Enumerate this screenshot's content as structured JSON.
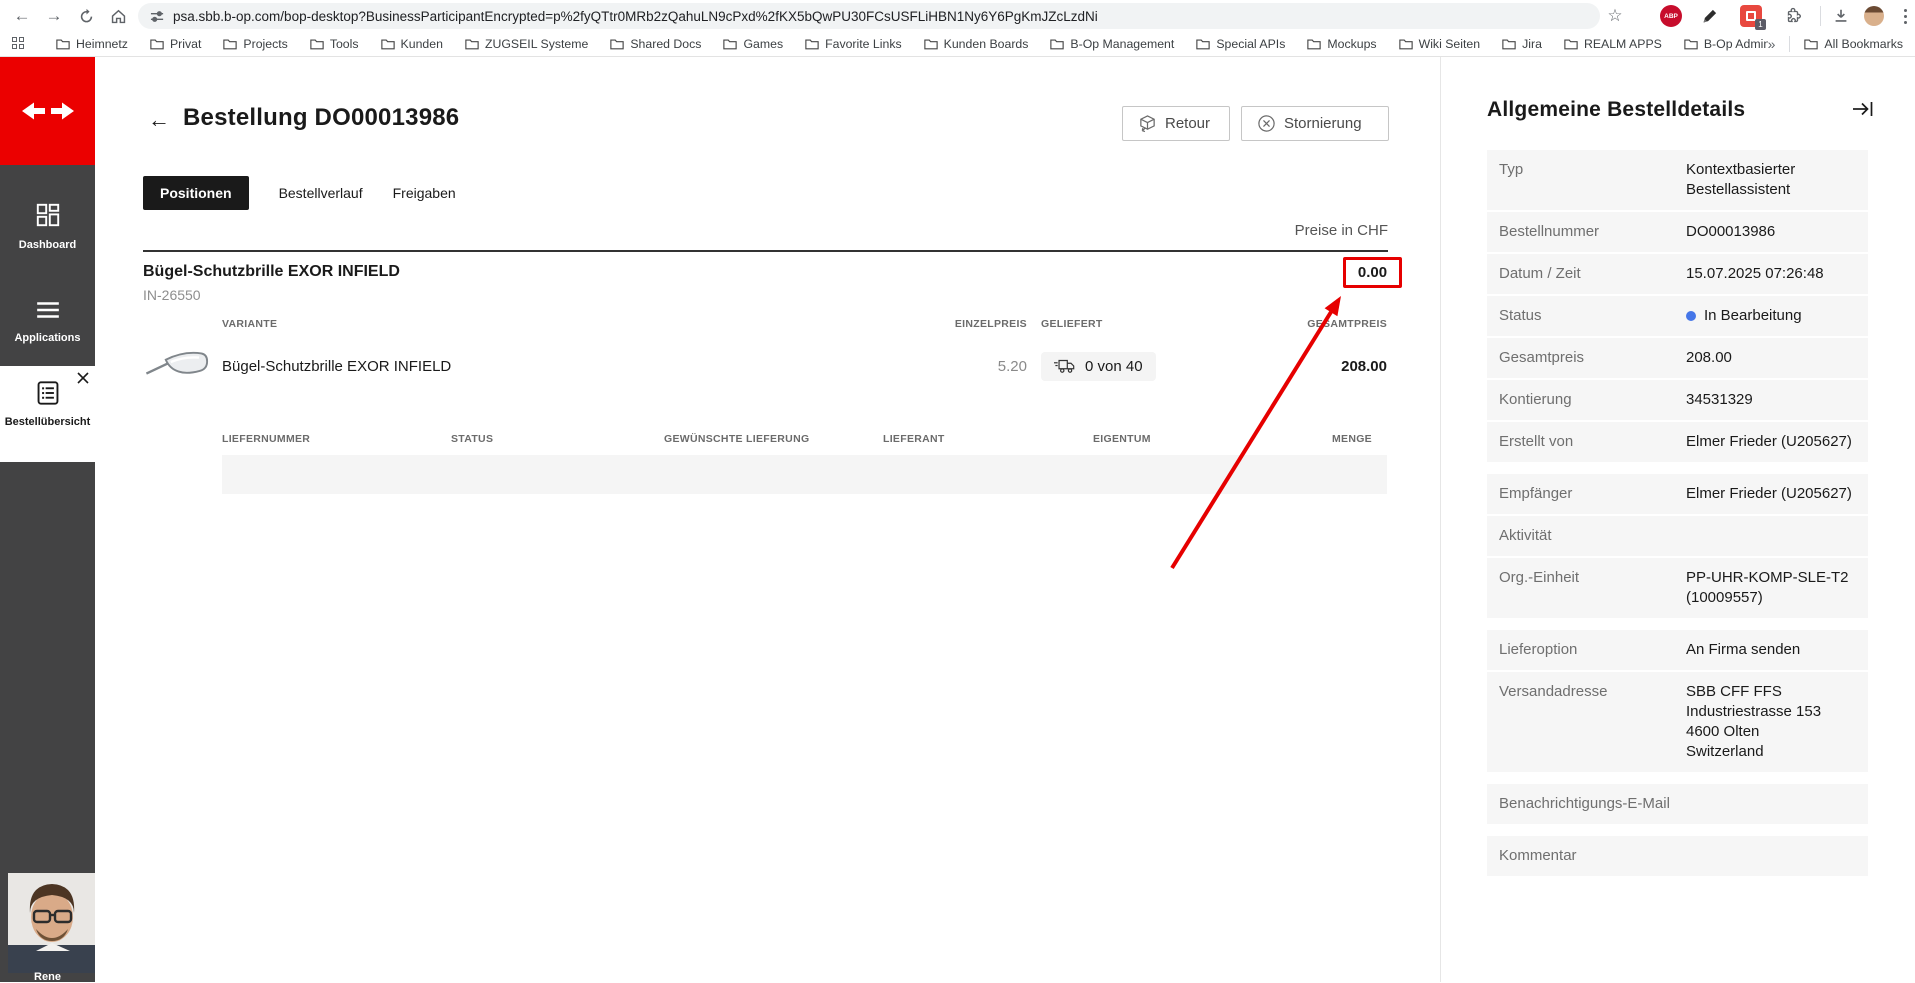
{
  "browser": {
    "url": "psa.sbb.b-op.com/bop-desktop?BusinessParticipantEncrypted=p%2fyQTtr0MRb2zQahuLN9cPxd%2fKX5bQwPU30FCsUSFLiHBN1Ny6Y6PgKmJZcLzdNi",
    "bookmarks": [
      "Heimnetz",
      "Privat",
      "Projects",
      "Tools",
      "Kunden",
      "ZUGSEIL Systeme",
      "Shared Docs",
      "Games",
      "Favorite Links",
      "Kunden Boards",
      "B-Op Management",
      "Special APIs",
      "Mockups",
      "Wiki Seiten",
      "Jira",
      "REALM APPS",
      "B-Op Admin"
    ],
    "bookmarks_overflow": "»",
    "all_bookmarks": "All Bookmarks",
    "abp_label": "ABP",
    "extension_badge": "1"
  },
  "sidebar": {
    "items": [
      {
        "label": "Dashboard"
      },
      {
        "label": "Applications"
      }
    ],
    "active_item": {
      "label": "Bestellübersicht"
    },
    "user": "Rene"
  },
  "header": {
    "title": "Bestellung DO00013986",
    "retour_label": "Retour",
    "stornierung_label": "Stornierung"
  },
  "tabs": [
    {
      "label": "Positionen",
      "active": true
    },
    {
      "label": "Bestellverlauf",
      "active": false
    },
    {
      "label": "Freigaben",
      "active": false
    }
  ],
  "order": {
    "currency_note": "Preise in CHF",
    "product_name": "Bügel-Schutzbrille EXOR INFIELD",
    "product_code": "IN-26550",
    "annotated_value": "0.00",
    "columns": [
      "VARIANTE",
      "EINZELPREIS",
      "GELIEFERT",
      "GESAMTPREIS"
    ],
    "variant": {
      "name": "Bügel-Schutzbrille EXOR INFIELD",
      "einzelpreis": "5.20",
      "geliefert": "0 von 40",
      "gesamtpreis": "208.00"
    },
    "delivery_columns": [
      "LIEFERNUMMER",
      "STATUS",
      "GEWÜNSCHTE LIEFERUNG",
      "LIEFERANT",
      "EIGENTUM",
      "MENGE"
    ]
  },
  "details": {
    "title": "Allgemeine Bestelldetails",
    "rows": [
      {
        "label": "Typ",
        "value": "Kontextbasierter Bestellassistent"
      },
      {
        "label": "Bestellnummer",
        "value": "DO00013986"
      },
      {
        "label": "Datum / Zeit",
        "value": "15.07.2025 07:26:48"
      },
      {
        "label": "Status",
        "value": "In Bearbeitung",
        "dot": "#4576e8"
      },
      {
        "label": "Gesamtpreis",
        "value": "208.00"
      },
      {
        "label": "Kontierung",
        "value": "34531329"
      },
      {
        "label": "Erstellt von",
        "value": "Elmer Frieder (U205627)",
        "gap_after": true
      },
      {
        "label": "Empfänger",
        "value": "Elmer Frieder (U205627)"
      },
      {
        "label": "Aktivität",
        "value": ""
      },
      {
        "label": "Org.-Einheit",
        "value": "PP-UHR-KOMP-SLE-T2 (10009557)",
        "gap_after": true
      },
      {
        "label": "Lieferoption",
        "value": "An Firma senden"
      },
      {
        "label": "Versandadresse",
        "value": "SBB CFF FFS\nIndustriestrasse 153\n4600 Olten\nSwitzerland",
        "gap_after": true
      },
      {
        "label": "Benachrichtigungs-E-Mail",
        "value": "",
        "gap_after": true
      },
      {
        "label": "Kommentar",
        "value": ""
      }
    ]
  },
  "colors": {
    "sbb_red": "#EB0000",
    "sidebar_dark": "#434344",
    "status_blue": "#4576e8",
    "annotation_red": "#e60000",
    "row_bg": "#f6f6f6"
  }
}
